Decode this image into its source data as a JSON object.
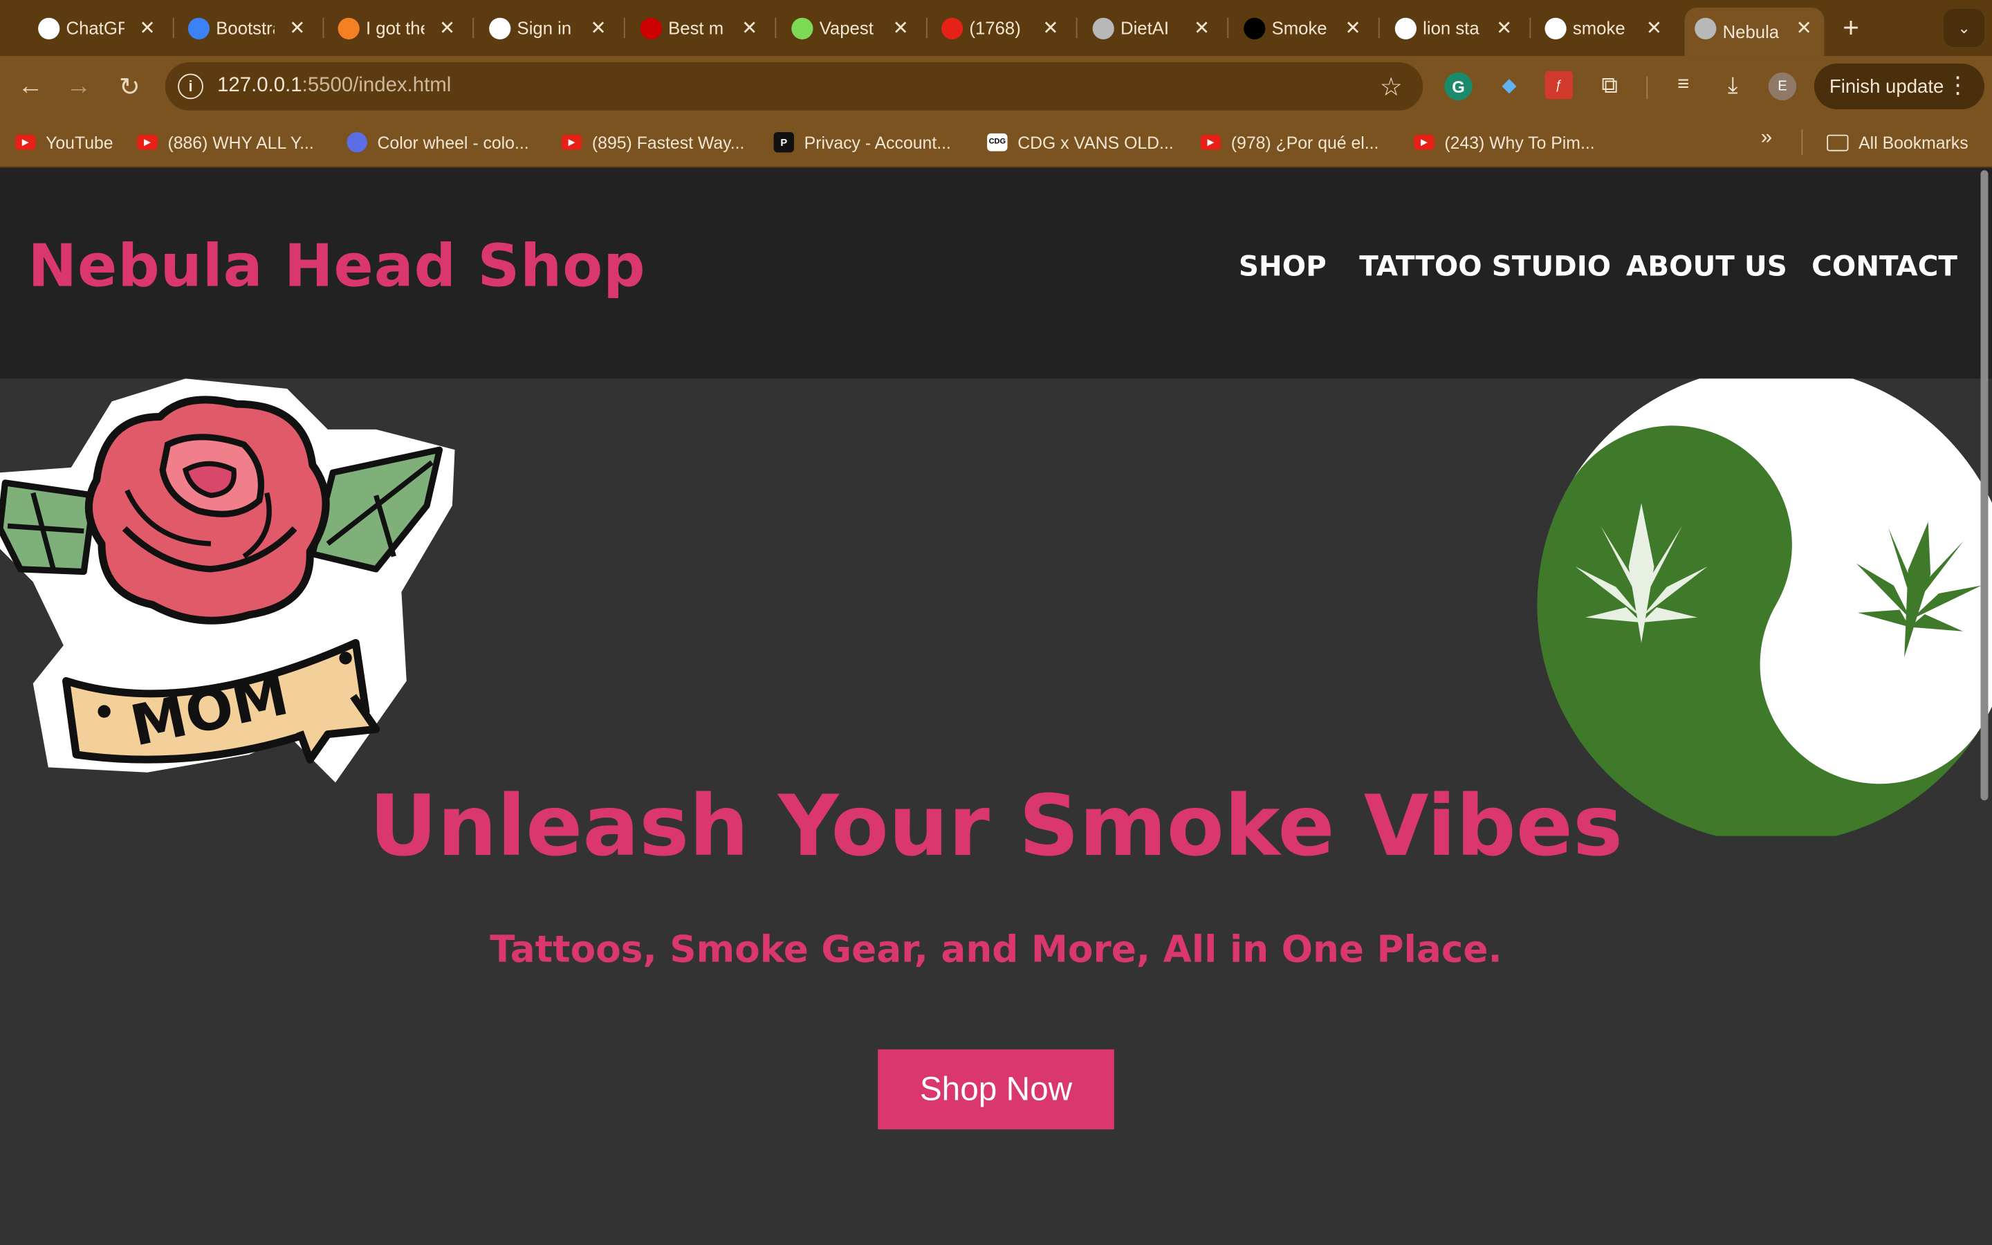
{
  "browser": {
    "tabs": [
      {
        "title": "ChatGPT",
        "icon": "chatgpt-icon",
        "color": "#ffffff"
      },
      {
        "title": "Bootstrap",
        "icon": "bootstrap-icon",
        "color": "#3b82f6"
      },
      {
        "title": "I got the",
        "icon": "stackoverflow-icon",
        "color": "#f48024"
      },
      {
        "title": "Sign in",
        "icon": "google-icon",
        "color": "#ffffff"
      },
      {
        "title": "Best m",
        "icon": "cnn-icon",
        "color": "#cc0000"
      },
      {
        "title": "Vapest",
        "icon": "vapestore-icon",
        "color": "#7ed957"
      },
      {
        "title": "(1768)",
        "icon": "youtube-icon",
        "color": "#e62117"
      },
      {
        "title": "DietAI",
        "icon": "globe-icon",
        "color": "#b8b8b8"
      },
      {
        "title": "Smoke",
        "icon": "x-icon",
        "color": "#000000"
      },
      {
        "title": "lion sta",
        "icon": "google-icon",
        "color": "#ffffff"
      },
      {
        "title": "smoke",
        "icon": "google-icon",
        "color": "#ffffff"
      },
      {
        "title": "Nebula",
        "icon": "globe-icon",
        "color": "#b8b8b8"
      }
    ],
    "url_host": "127.0.0.1",
    "url_rest": ":5500/index.html",
    "finish_update": "Finish update",
    "profile_initial": "E",
    "bookmarks": [
      {
        "label": "YouTube",
        "icon": "youtube-icon"
      },
      {
        "label": "(886) WHY ALL Y...",
        "icon": "youtube-icon"
      },
      {
        "label": "Color wheel - colo...",
        "icon": "canva-icon"
      },
      {
        "label": "(895) Fastest Way...",
        "icon": "youtube-icon"
      },
      {
        "label": "Privacy - Account...",
        "icon": "privacy-icon"
      },
      {
        "label": "CDG x VANS OLD...",
        "icon": "cdg-icon"
      },
      {
        "label": "(978) ¿Por qué el...",
        "icon": "youtube-icon"
      },
      {
        "label": "(243) Why To Pim...",
        "icon": "youtube-icon"
      }
    ],
    "all_bookmarks": "All Bookmarks"
  },
  "site": {
    "logo": "Nebula Head Shop",
    "nav": [
      "SHOP",
      "TATTOO STUDIO",
      "ABOUT US",
      "CONTACT"
    ],
    "hero_title": "Unleash Your Smoke Vibes",
    "hero_subtitle": "Tattoos, Smoke Gear, and More, All in One Place.",
    "cta": "Shop Now",
    "tattoo_banner": "MOM",
    "colors": {
      "accent": "#d9376e",
      "header_bg": "#222222",
      "page_bg": "#333333",
      "leaf_green": "#3b7a2a"
    }
  }
}
